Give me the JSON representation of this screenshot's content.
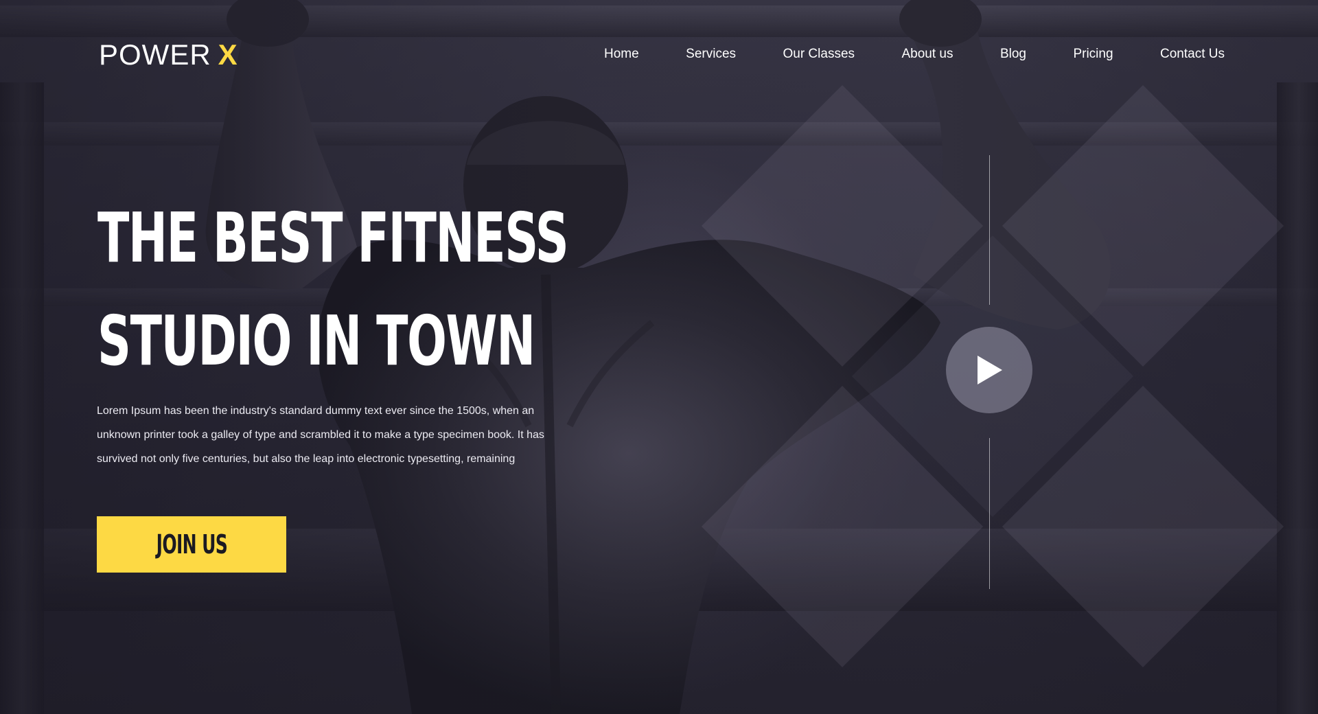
{
  "brand": {
    "name": "POWER",
    "mark": "X",
    "accent_color": "#fdd944"
  },
  "nav": {
    "items": [
      {
        "label": "Home"
      },
      {
        "label": "Services"
      },
      {
        "label": "Our Classes"
      },
      {
        "label": "About us"
      },
      {
        "label": "Blog"
      },
      {
        "label": "Pricing"
      },
      {
        "label": "Contact Us"
      }
    ]
  },
  "hero": {
    "headline_line1": "THE BEST FITNESS",
    "headline_line2": "STUDIO IN TOWN",
    "description_line1": "Lorem Ipsum has been the industry's standard dummy text ever since the 1500s, when an",
    "description_line2": "unknown printer took a galley of type and scrambled it to make a type specimen book. It has",
    "description_line3": "survived not only five centuries, but also the leap into electronic typesetting, remaining",
    "cta_label": "JOIN US",
    "background_image": "muscular man doing pull-ups, viewed from behind"
  },
  "video": {
    "icon": "play-icon"
  },
  "colors": {
    "background": "#24222f",
    "text": "#ffffff",
    "button": "#fdd944",
    "button_text": "#1b1a22"
  }
}
